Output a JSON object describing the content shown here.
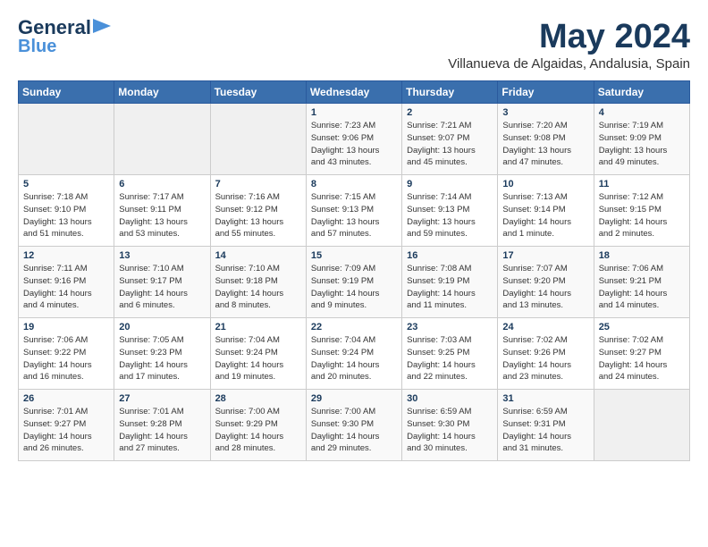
{
  "header": {
    "logo_line1": "General",
    "logo_line2": "Blue",
    "month_year": "May 2024",
    "location": "Villanueva de Algaidas, Andalusia, Spain"
  },
  "calendar": {
    "days_of_week": [
      "Sunday",
      "Monday",
      "Tuesday",
      "Wednesday",
      "Thursday",
      "Friday",
      "Saturday"
    ],
    "weeks": [
      [
        {
          "day": "",
          "info": ""
        },
        {
          "day": "",
          "info": ""
        },
        {
          "day": "",
          "info": ""
        },
        {
          "day": "1",
          "info": "Sunrise: 7:23 AM\nSunset: 9:06 PM\nDaylight: 13 hours\nand 43 minutes."
        },
        {
          "day": "2",
          "info": "Sunrise: 7:21 AM\nSunset: 9:07 PM\nDaylight: 13 hours\nand 45 minutes."
        },
        {
          "day": "3",
          "info": "Sunrise: 7:20 AM\nSunset: 9:08 PM\nDaylight: 13 hours\nand 47 minutes."
        },
        {
          "day": "4",
          "info": "Sunrise: 7:19 AM\nSunset: 9:09 PM\nDaylight: 13 hours\nand 49 minutes."
        }
      ],
      [
        {
          "day": "5",
          "info": "Sunrise: 7:18 AM\nSunset: 9:10 PM\nDaylight: 13 hours\nand 51 minutes."
        },
        {
          "day": "6",
          "info": "Sunrise: 7:17 AM\nSunset: 9:11 PM\nDaylight: 13 hours\nand 53 minutes."
        },
        {
          "day": "7",
          "info": "Sunrise: 7:16 AM\nSunset: 9:12 PM\nDaylight: 13 hours\nand 55 minutes."
        },
        {
          "day": "8",
          "info": "Sunrise: 7:15 AM\nSunset: 9:13 PM\nDaylight: 13 hours\nand 57 minutes."
        },
        {
          "day": "9",
          "info": "Sunrise: 7:14 AM\nSunset: 9:13 PM\nDaylight: 13 hours\nand 59 minutes."
        },
        {
          "day": "10",
          "info": "Sunrise: 7:13 AM\nSunset: 9:14 PM\nDaylight: 14 hours\nand 1 minute."
        },
        {
          "day": "11",
          "info": "Sunrise: 7:12 AM\nSunset: 9:15 PM\nDaylight: 14 hours\nand 2 minutes."
        }
      ],
      [
        {
          "day": "12",
          "info": "Sunrise: 7:11 AM\nSunset: 9:16 PM\nDaylight: 14 hours\nand 4 minutes."
        },
        {
          "day": "13",
          "info": "Sunrise: 7:10 AM\nSunset: 9:17 PM\nDaylight: 14 hours\nand 6 minutes."
        },
        {
          "day": "14",
          "info": "Sunrise: 7:10 AM\nSunset: 9:18 PM\nDaylight: 14 hours\nand 8 minutes."
        },
        {
          "day": "15",
          "info": "Sunrise: 7:09 AM\nSunset: 9:19 PM\nDaylight: 14 hours\nand 9 minutes."
        },
        {
          "day": "16",
          "info": "Sunrise: 7:08 AM\nSunset: 9:19 PM\nDaylight: 14 hours\nand 11 minutes."
        },
        {
          "day": "17",
          "info": "Sunrise: 7:07 AM\nSunset: 9:20 PM\nDaylight: 14 hours\nand 13 minutes."
        },
        {
          "day": "18",
          "info": "Sunrise: 7:06 AM\nSunset: 9:21 PM\nDaylight: 14 hours\nand 14 minutes."
        }
      ],
      [
        {
          "day": "19",
          "info": "Sunrise: 7:06 AM\nSunset: 9:22 PM\nDaylight: 14 hours\nand 16 minutes."
        },
        {
          "day": "20",
          "info": "Sunrise: 7:05 AM\nSunset: 9:23 PM\nDaylight: 14 hours\nand 17 minutes."
        },
        {
          "day": "21",
          "info": "Sunrise: 7:04 AM\nSunset: 9:24 PM\nDaylight: 14 hours\nand 19 minutes."
        },
        {
          "day": "22",
          "info": "Sunrise: 7:04 AM\nSunset: 9:24 PM\nDaylight: 14 hours\nand 20 minutes."
        },
        {
          "day": "23",
          "info": "Sunrise: 7:03 AM\nSunset: 9:25 PM\nDaylight: 14 hours\nand 22 minutes."
        },
        {
          "day": "24",
          "info": "Sunrise: 7:02 AM\nSunset: 9:26 PM\nDaylight: 14 hours\nand 23 minutes."
        },
        {
          "day": "25",
          "info": "Sunrise: 7:02 AM\nSunset: 9:27 PM\nDaylight: 14 hours\nand 24 minutes."
        }
      ],
      [
        {
          "day": "26",
          "info": "Sunrise: 7:01 AM\nSunset: 9:27 PM\nDaylight: 14 hours\nand 26 minutes."
        },
        {
          "day": "27",
          "info": "Sunrise: 7:01 AM\nSunset: 9:28 PM\nDaylight: 14 hours\nand 27 minutes."
        },
        {
          "day": "28",
          "info": "Sunrise: 7:00 AM\nSunset: 9:29 PM\nDaylight: 14 hours\nand 28 minutes."
        },
        {
          "day": "29",
          "info": "Sunrise: 7:00 AM\nSunset: 9:30 PM\nDaylight: 14 hours\nand 29 minutes."
        },
        {
          "day": "30",
          "info": "Sunrise: 6:59 AM\nSunset: 9:30 PM\nDaylight: 14 hours\nand 30 minutes."
        },
        {
          "day": "31",
          "info": "Sunrise: 6:59 AM\nSunset: 9:31 PM\nDaylight: 14 hours\nand 31 minutes."
        },
        {
          "day": "",
          "info": ""
        }
      ]
    ]
  }
}
